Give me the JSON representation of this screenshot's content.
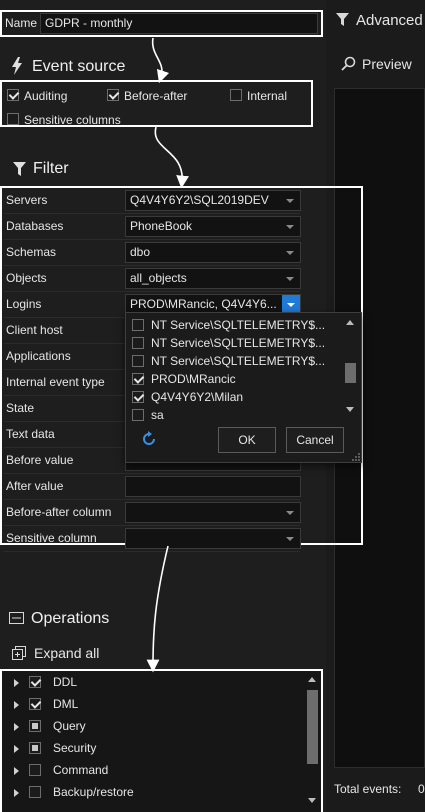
{
  "name_field": {
    "label": "Name",
    "value": "GDPR - monthly"
  },
  "right_panel": {
    "advanced_label": "Advanced",
    "preview_label": "Preview",
    "total_events_label": "Total events:",
    "total_events_value": "0"
  },
  "event_source": {
    "title": "Event source",
    "options": [
      {
        "label": "Auditing",
        "checked": true
      },
      {
        "label": "Before-after",
        "checked": true
      },
      {
        "label": "Internal",
        "checked": false
      },
      {
        "label": "Sensitive columns",
        "checked": false
      }
    ]
  },
  "filter": {
    "title": "Filter",
    "rows": [
      {
        "label": "Servers",
        "value": "Q4V4Y6Y2\\SQL2019DEV"
      },
      {
        "label": "Databases",
        "value": "PhoneBook"
      },
      {
        "label": "Schemas",
        "value": "dbo"
      },
      {
        "label": "Objects",
        "value": "all_objects"
      },
      {
        "label": "Logins",
        "value": "PROD\\MRancic, Q4V4Y6..."
      },
      {
        "label": "Client host",
        "value": ""
      },
      {
        "label": "Applications",
        "value": ""
      },
      {
        "label": "Internal event type",
        "value": ""
      },
      {
        "label": "State",
        "value": ""
      },
      {
        "label": "Text data",
        "value": ""
      },
      {
        "label": "Before value",
        "value": ""
      },
      {
        "label": "After value",
        "value": ""
      },
      {
        "label": "Before-after column",
        "value": ""
      },
      {
        "label": "Sensitive column",
        "value": ""
      }
    ],
    "logins_dropdown": {
      "items": [
        {
          "label": "NT Service\\SQLTELEMETRY$...",
          "checked": false
        },
        {
          "label": "NT Service\\SQLTELEMETRY$...",
          "checked": false
        },
        {
          "label": "NT Service\\SQLTELEMETRY$...",
          "checked": false
        },
        {
          "label": "PROD\\MRancic",
          "checked": true
        },
        {
          "label": "Q4V4Y6Y2\\Milan",
          "checked": true
        },
        {
          "label": "sa",
          "checked": false
        }
      ],
      "ok_label": "OK",
      "cancel_label": "Cancel"
    }
  },
  "operations": {
    "title": "Operations",
    "expand_all_label": "Expand all",
    "items": [
      {
        "label": "DDL",
        "state": "checked"
      },
      {
        "label": "DML",
        "state": "checked"
      },
      {
        "label": "Query",
        "state": "partial"
      },
      {
        "label": "Security",
        "state": "partial"
      },
      {
        "label": "Command",
        "state": "unchecked"
      },
      {
        "label": "Backup/restore",
        "state": "unchecked"
      }
    ]
  },
  "colors": {
    "background": "#1e1e1e",
    "highlight_box": "#ffffff",
    "dropdown_accent": "#1f7bd6",
    "refresh_icon": "#3a8ee6"
  }
}
